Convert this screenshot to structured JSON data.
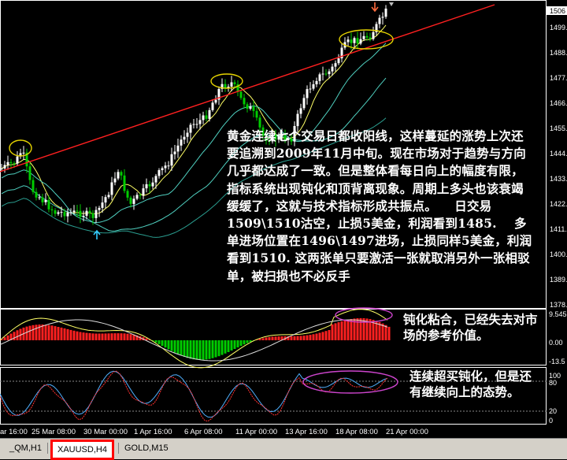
{
  "window": {
    "symbol": "XAUUSD",
    "timeframe": "H4"
  },
  "price_axis": {
    "labels": [
      "1506",
      "1499.",
      "1488.",
      "1477.",
      "1466.",
      "1455.",
      "1444.",
      "1433.",
      "1422.",
      "1411.",
      "1400.",
      "1389.",
      "1378."
    ]
  },
  "macd_axis": {
    "labels": [
      "9.545",
      "0.00",
      "-13.5"
    ]
  },
  "stoch_axis": {
    "labels": [
      "100",
      "80",
      "20",
      "0"
    ]
  },
  "time_axis": {
    "labels": [
      "ar 16:00",
      "25 Mar 08:00",
      "30 Mar 00:00",
      "1 Apr 16:00",
      "6 Apr 08:00",
      "11 Apr 00:00",
      "13 Apr 16:00",
      "18 Apr 08:00",
      "21 Apr 00:00"
    ]
  },
  "annotations": {
    "main": "黄金连续七个交易日都收阳线，这样蔓延的涨势上次还要追溯到2009年11月中旬。现在市场对于趋势与方向几乎都达成了一致。但是整体看每日向上的幅度有限，指标系统出现钝化和顶背离现象。周期上多头也该衰竭缓缓了，这就与技术指标形成共振点。    日交易1509\\1510沽空，止损5美金，利润看到1485.    多单进场位置在1496\\1497进场，止损同样5美金，利润看到1510. 这两张单只要激活一张就取消另外一张相驳单，被扫损也不必反手",
    "macd": "钝化粘合，已经失去对市场的参考价值。",
    "stoch": "连续超买钝化，但是还有继续向上的态势。"
  },
  "tabs": [
    {
      "label": "_QM,H1",
      "active": false
    },
    {
      "label": "XAUUSD,H4",
      "active": true
    },
    {
      "label": "GOLD,M15",
      "active": false
    }
  ],
  "colors": {
    "bull": "#ffffff",
    "bear": "#00cc00",
    "trendline": "#ff2020",
    "ellipse_main": "#e6d400",
    "ellipse_osc": "#cc44cc",
    "macd_pos": "#ff2020",
    "macd_neg": "#00cc00",
    "ma_fast": "#ffff66",
    "ma_slow": "#4fd0c0",
    "arrow_up": "#33ccff",
    "arrow_down": "#ff6a3c"
  }
}
